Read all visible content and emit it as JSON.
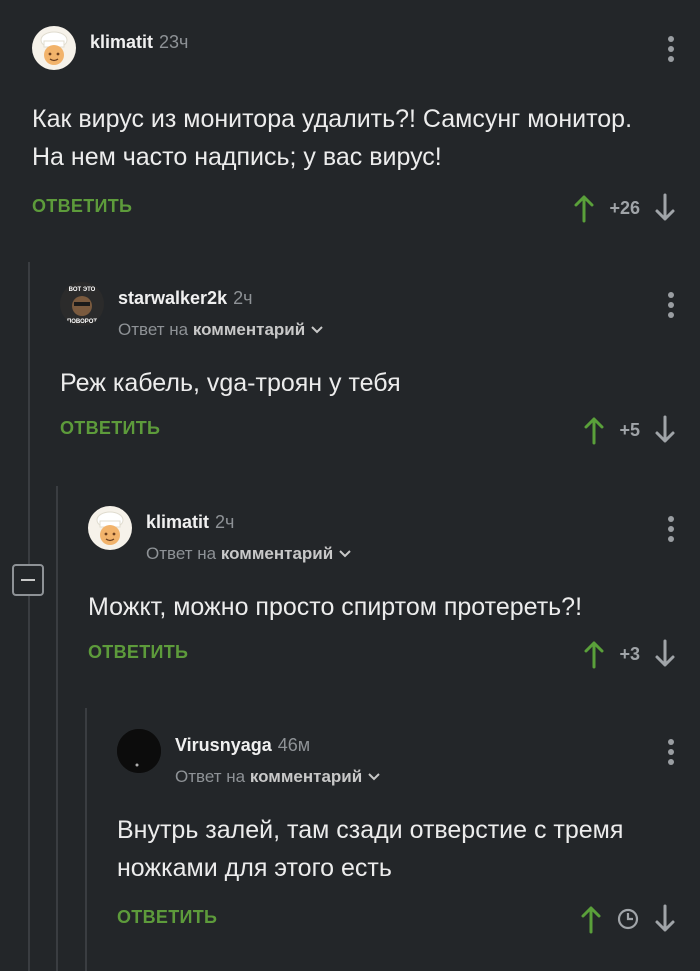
{
  "comments": [
    {
      "username": "klimatit",
      "time": "23ч",
      "text": "Как вирус из монитора удалить?! Самсунг монитор. На нем часто надпись; у вас вирус!",
      "reply_label": "ОТВЕТИТЬ",
      "score": "+26"
    },
    {
      "username": "starwalker2k",
      "time": "2ч",
      "reply_prefix": "Ответ на",
      "reply_target": "комментарий",
      "avatar_caption_top": "ВОТ ЭТО",
      "avatar_caption_bottom": "ПОВОРОТ",
      "text": "Реж кабель, vga-троян у тебя",
      "reply_label": "ОТВЕТИТЬ",
      "score": "+5"
    },
    {
      "username": "klimatit",
      "time": "2ч",
      "reply_prefix": "Ответ на",
      "reply_target": "комментарий",
      "text": "Можкт, можно просто спиртом протереть?!",
      "reply_label": "ОТВЕТИТЬ",
      "score": "+3"
    },
    {
      "username": "Virusnyaga",
      "time": "46м",
      "reply_prefix": "Ответ на",
      "reply_target": "комментарий",
      "text": "Внутрь залей, там сзади отверстие с тремя ножками для этого есть",
      "reply_label": "ОТВЕТИТЬ",
      "score_icon": "clock-icon"
    }
  ],
  "colors": {
    "background": "#232629",
    "accent_green": "#5d9b3b",
    "upvote_green": "#5aa03a",
    "muted": "#8e9296"
  }
}
